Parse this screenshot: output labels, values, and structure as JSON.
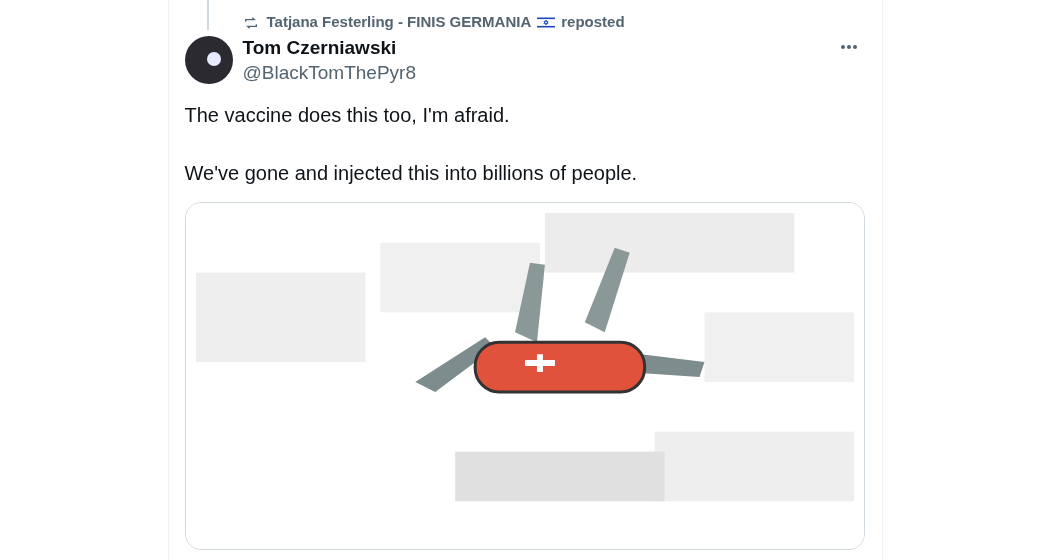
{
  "repost": {
    "name": "Tatjana Festerling - FINIS GERMANIA",
    "suffix": "reposted"
  },
  "author": {
    "name": "Tom Czerniawski",
    "handle": "@BlackTomThePyr8"
  },
  "paragraphs": [
    "The vaccine does this too, I'm afraid.",
    "We've gone and injected this into billions of people."
  ]
}
